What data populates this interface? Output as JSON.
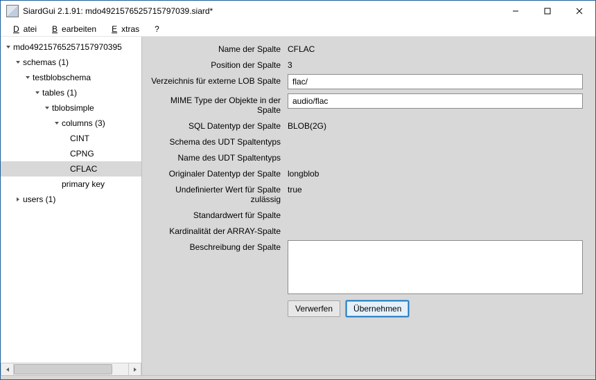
{
  "window": {
    "title": "SiardGui 2.1.91: mdo4921576525715797039.siard*"
  },
  "menu": {
    "file_u": "D",
    "file_r": "atei",
    "edit_u": "B",
    "edit_r": "earbeiten",
    "extras_u": "E",
    "extras_r": "xtras",
    "help": "?"
  },
  "tree": {
    "root": "mdo49215765257157970395",
    "schemas": "schemas (1)",
    "schema": "testblobschema",
    "tables": "tables (1)",
    "table": "tblobsimple",
    "columns": "columns (3)",
    "col1": "CINT",
    "col2": "CPNG",
    "col3": "CFLAC",
    "pkey": "primary key",
    "users": "users (1)"
  },
  "form": {
    "labels": {
      "name": "Name der Spalte",
      "position": "Position der Spalte",
      "lobdir": "Verzeichnis für externe LOB Spalte",
      "mime": "MIME Type der Objekte in der Spalte",
      "sqltype": "SQL Datentyp der Spalte",
      "udtschema": "Schema des UDT Spaltentyps",
      "udtname": "Name des UDT Spaltentyps",
      "origtype": "Originaler Datentyp der Spalte",
      "nullable": "Undefinierter Wert für Spalte zulässig",
      "default": "Standardwert für Spalte",
      "cardinality": "Kardinalität der ARRAY-Spalte",
      "description": "Beschreibung der Spalte"
    },
    "values": {
      "name": "CFLAC",
      "position": "3",
      "lobdir": "flac/",
      "mime": "audio/flac",
      "sqltype": "BLOB(2G)",
      "udtschema": "",
      "udtname": "",
      "origtype": "longblob",
      "nullable": "true",
      "default": "",
      "cardinality": ""
    },
    "buttons": {
      "discard": "Verwerfen",
      "apply": "Übernehmen"
    }
  }
}
